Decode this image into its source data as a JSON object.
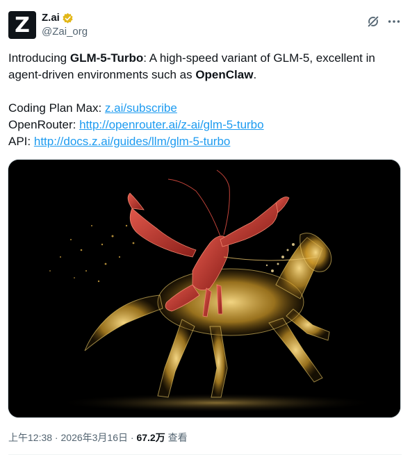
{
  "author": {
    "avatar_letter": "Z",
    "display_name": "Z.ai",
    "handle": "@Zai_org",
    "verified_color": "#E2B719"
  },
  "body": {
    "intro": "Introducing ",
    "product": "GLM-5-Turbo",
    "desc1": ": A high-speed variant of GLM-5, excellent in agent-driven environments such as ",
    "brand": "OpenClaw",
    "desc_end": ".",
    "coding_label": "Coding Plan Max: ",
    "coding_link": "z.ai/subscribe",
    "openrouter_label": "OpenRouter: ",
    "openrouter_link": "http://openrouter.ai/z-ai/glm-5-turbo",
    "api_label": "API: ",
    "api_link": "http://docs.z.ai/guides/llm/glm-5-turbo"
  },
  "meta": {
    "time": "上午12:38",
    "sep1": " · ",
    "date": "2026年3月16日",
    "sep2": " · ",
    "views_count": "67.2万",
    "views_label": " 查看"
  },
  "icons": {
    "grok": "grok-icon",
    "more": "more-options-icon",
    "verified": "verified-badge-icon"
  },
  "colors": {
    "link": "#1d9bf0",
    "secondary_text": "#536471",
    "gold": "#E2B719",
    "crawfish": "#B5322A"
  }
}
